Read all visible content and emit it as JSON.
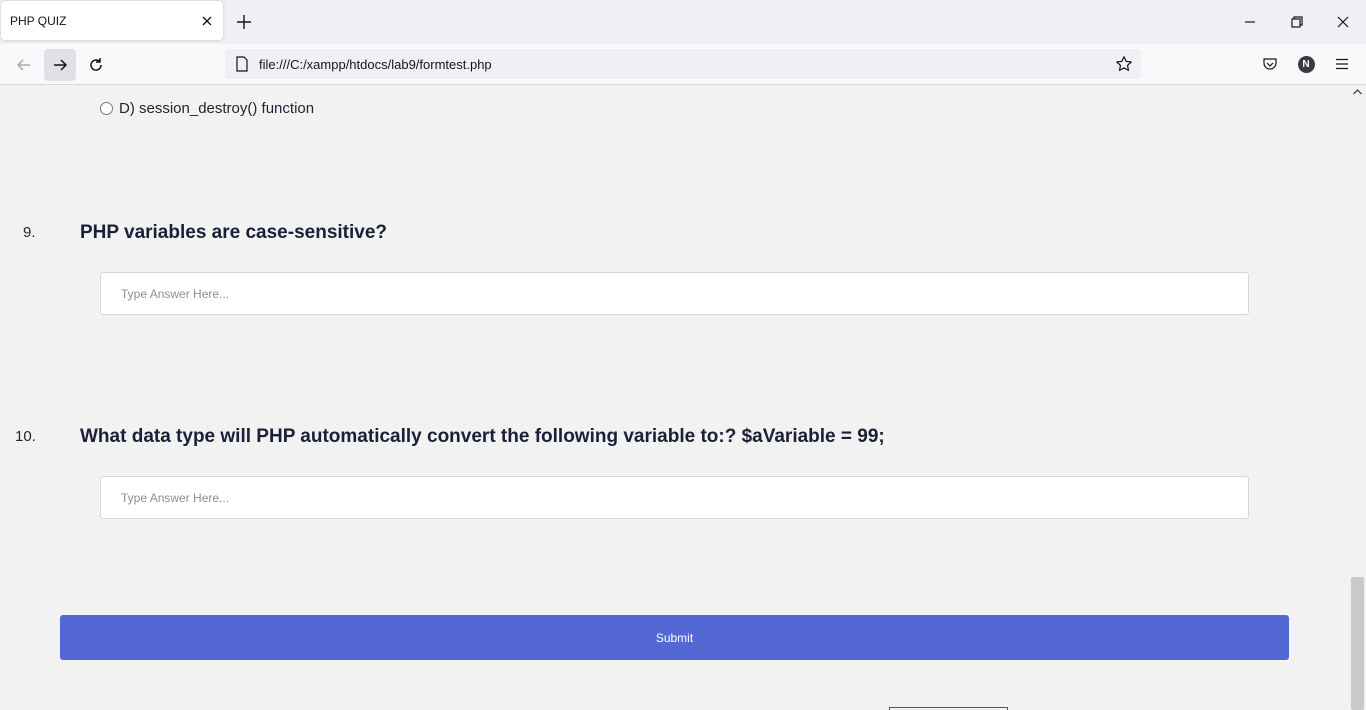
{
  "browser": {
    "tab_title": "PHP QUIZ",
    "url": "file:///C:/xampp/htdocs/lab9/formtest.php",
    "profile_initial": "N"
  },
  "quiz": {
    "prev_option_label": "D) session_destroy() function",
    "questions": [
      {
        "number": "9.",
        "text": "PHP variables are case-sensitive?",
        "placeholder": "Type Answer Here...",
        "value": ""
      },
      {
        "number": "10.",
        "text": "What data type will PHP automatically convert the following variable to:? $aVariable = 99;",
        "placeholder": "Type Answer Here...",
        "value": ""
      }
    ],
    "submit_label": "Submit"
  },
  "colors": {
    "submit_button": "#5468d4",
    "page_background": "#f2f2f2"
  },
  "icons": [
    "close-icon",
    "plus-icon",
    "minimize-icon",
    "restore-icon",
    "back-arrow-icon",
    "forward-arrow-icon",
    "reload-icon",
    "page-icon",
    "star-icon",
    "pocket-icon",
    "menu-icon"
  ]
}
